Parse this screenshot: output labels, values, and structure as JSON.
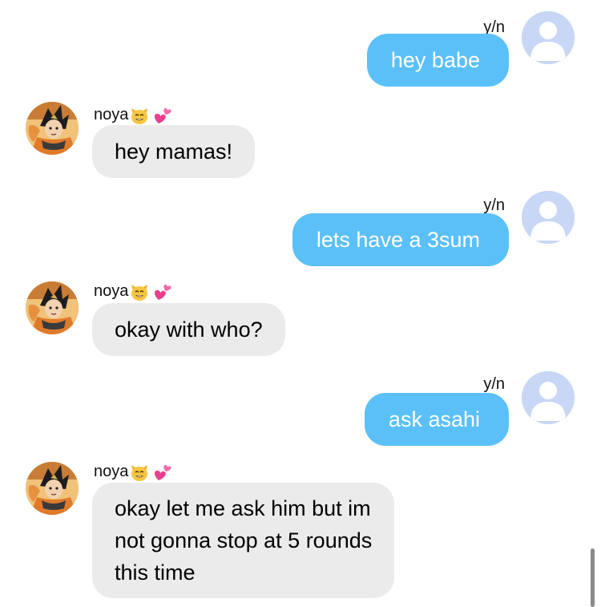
{
  "colors": {
    "outgoing_bubble": "#5bc0f8",
    "incoming_bubble": "#ebebeb",
    "user_avatar_bg": "#c9d7f6"
  },
  "messages": [
    {
      "sender": "y/n",
      "direction": "outgoing",
      "text": "hey babe",
      "avatar": "default-user-avatar"
    },
    {
      "sender": "noya",
      "direction": "incoming",
      "text": "hey mamas!",
      "avatar": "noya-avatar",
      "name_emojis": [
        "cat-face-icon",
        "two-hearts-icon"
      ]
    },
    {
      "sender": "y/n",
      "direction": "outgoing",
      "text": "lets have a 3sum",
      "avatar": "default-user-avatar"
    },
    {
      "sender": "noya",
      "direction": "incoming",
      "text": "okay with who?",
      "avatar": "noya-avatar",
      "name_emojis": [
        "cat-face-icon",
        "two-hearts-icon"
      ]
    },
    {
      "sender": "y/n",
      "direction": "outgoing",
      "text": "ask asahi",
      "avatar": "default-user-avatar"
    },
    {
      "sender": "noya",
      "direction": "incoming",
      "lines": [
        "okay let me ask him but im",
        "not gonna stop at 5 rounds",
        "this time"
      ],
      "avatar": "noya-avatar",
      "name_emojis": [
        "cat-face-icon",
        "two-hearts-icon"
      ]
    }
  ]
}
